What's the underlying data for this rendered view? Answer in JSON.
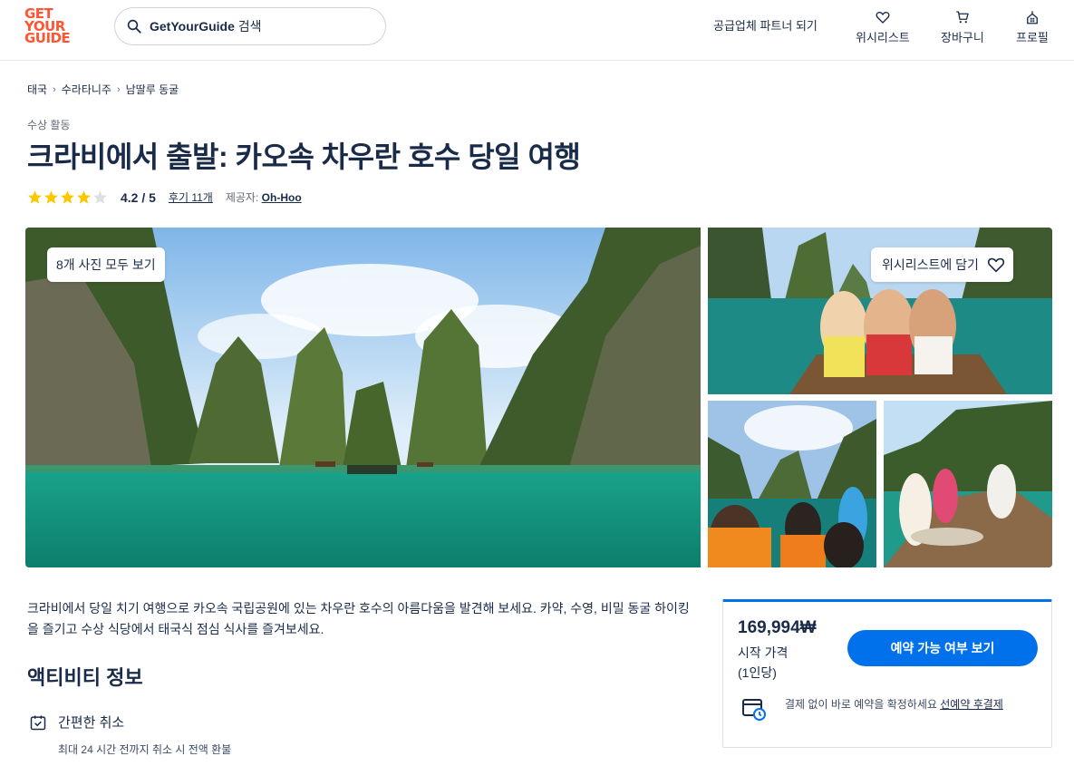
{
  "header": {
    "logo_lines": [
      "GET",
      "YOUR",
      "GUIDE"
    ],
    "search_brand": "GetYourGuide",
    "search_suffix": "검색",
    "partner_link": "공급업체 파트너 되기",
    "nav": [
      {
        "label": "위시리스트",
        "icon": "heart-icon"
      },
      {
        "label": "장바구니",
        "icon": "cart-icon"
      },
      {
        "label": "프로필",
        "icon": "profile-icon"
      }
    ]
  },
  "breadcrumb": [
    "태국",
    "수라타니주",
    "남딸루 동굴"
  ],
  "category": "수상 활동",
  "title": "크라비에서 출발: 카오속 차우란 호수 당일 여행",
  "rating": {
    "stars": 4,
    "value": "4.2 / 5",
    "reviews": "후기 11개",
    "provider_label": "제공자:",
    "provider_name": "Oh-Hoo"
  },
  "gallery": {
    "all_photos": "8개 사진 모두 보기",
    "wishlist": "위시리스트에 담기"
  },
  "description": "크라비에서 당일 치기 여행으로 카오속 국립공원에 있는 차우란 호수의 아름다움을 발견해 보세요. 카약, 수영, 비밀 동굴 하이킹을 즐기고 수상 식당에서 태국식 점심 식사를 즐겨보세요.",
  "activity": {
    "title": "액티비티 정보",
    "features": [
      {
        "label": "간편한 취소",
        "sub": "최대 24 시간 전까지 취소 시 전액 환불",
        "icon": "calendar-check-icon"
      }
    ]
  },
  "booking": {
    "price": "169,994₩",
    "price_label": "시작 가격",
    "price_per": "(1인당)",
    "button": "예약 가능 여부 보기",
    "note": "결제 없이 바로 예약을 확정하세요",
    "note_link": "선예약 후결제"
  },
  "colors": {
    "brand": "#ff5533",
    "accent": "#0071eb",
    "star": "#fdc700",
    "text": "#1a2b49"
  }
}
